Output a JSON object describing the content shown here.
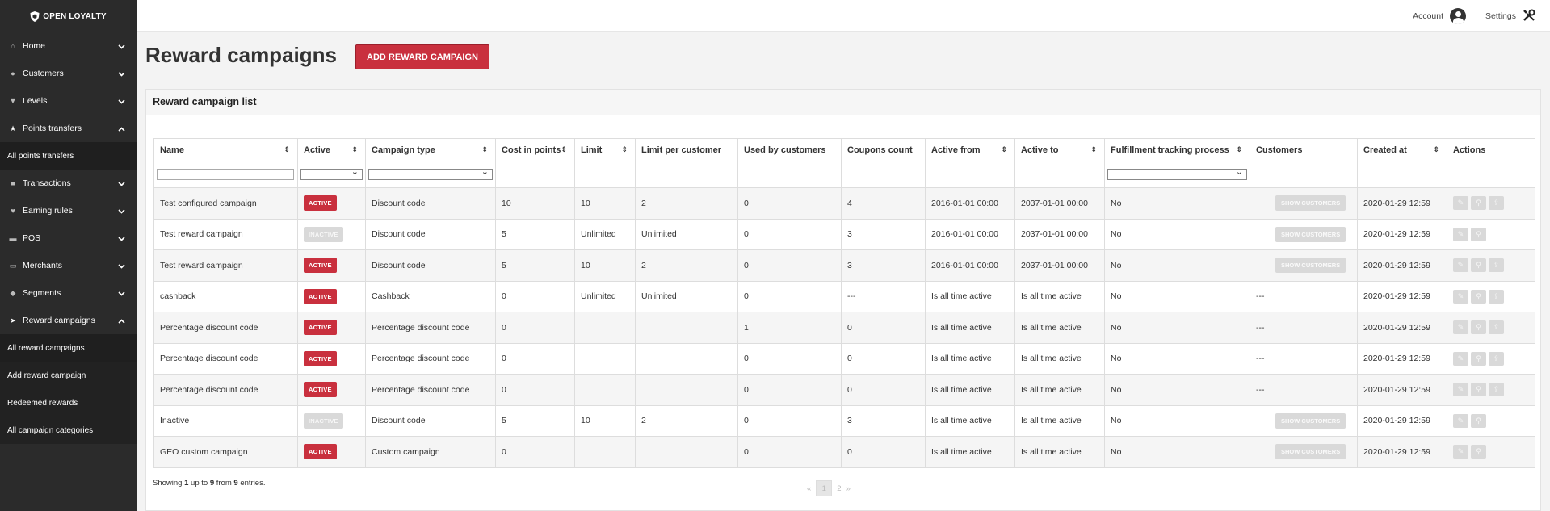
{
  "brand": {
    "name": "OPEN LOYALTY"
  },
  "topbar": {
    "account_label": "Account",
    "settings_label": "Settings"
  },
  "sidebar": {
    "items": [
      {
        "label": "Home",
        "icon": "home-icon",
        "expanded": false
      },
      {
        "label": "Customers",
        "icon": "users-icon",
        "expanded": false
      },
      {
        "label": "Levels",
        "icon": "trophy-icon",
        "expanded": false
      },
      {
        "label": "Points transfers",
        "icon": "star-icon",
        "expanded": true,
        "sub": [
          "All points transfers"
        ]
      },
      {
        "label": "Transactions",
        "icon": "bag-icon",
        "expanded": false
      },
      {
        "label": "Earning rules",
        "icon": "heart-icon",
        "expanded": false
      },
      {
        "label": "POS",
        "icon": "monitor-icon",
        "expanded": false
      },
      {
        "label": "Merchants",
        "icon": "card-icon",
        "expanded": false
      },
      {
        "label": "Segments",
        "icon": "tags-icon",
        "expanded": false
      },
      {
        "label": "Reward campaigns",
        "icon": "send-icon",
        "expanded": true,
        "sub": [
          "All reward campaigns",
          "Add reward campaign",
          "Redeemed rewards",
          "All campaign categories"
        ]
      }
    ]
  },
  "page": {
    "title": "Reward campaigns",
    "add_button": "ADD REWARD CAMPAIGN"
  },
  "panel": {
    "title": "Reward campaign list"
  },
  "table": {
    "columns": [
      "Name",
      "Active",
      "Campaign type",
      "Cost in points",
      "Limit",
      "Limit per customer",
      "Used by customers",
      "Coupons count",
      "Active from",
      "Active to",
      "Fulfillment tracking process",
      "Customers",
      "Created at",
      "Actions"
    ],
    "show_customers_label": "SHOW CUSTOMERS",
    "rows": [
      {
        "name": "Test configured campaign",
        "active": "ACTIVE",
        "type": "Discount code",
        "cost": "10",
        "limit": "10",
        "limit_per_customer": "2",
        "used": "0",
        "coupons": "4",
        "from": "2016-01-01 00:00",
        "to": "2037-01-01 00:00",
        "fulfillment": "No",
        "customers": "",
        "created": "2020-01-29 12:59"
      },
      {
        "name": "Test reward campaign",
        "active": "INACTIVE",
        "type": "Discount code",
        "cost": "5",
        "limit": "Unlimited",
        "limit_per_customer": "Unlimited",
        "used": "0",
        "coupons": "3",
        "from": "2016-01-01 00:00",
        "to": "2037-01-01 00:00",
        "fulfillment": "No",
        "customers": "",
        "created": "2020-01-29 12:59"
      },
      {
        "name": "Test reward campaign",
        "active": "ACTIVE",
        "type": "Discount code",
        "cost": "5",
        "limit": "10",
        "limit_per_customer": "2",
        "used": "0",
        "coupons": "3",
        "from": "2016-01-01 00:00",
        "to": "2037-01-01 00:00",
        "fulfillment": "No",
        "customers": "",
        "created": "2020-01-29 12:59"
      },
      {
        "name": "cashback",
        "active": "ACTIVE",
        "type": "Cashback",
        "cost": "0",
        "limit": "Unlimited",
        "limit_per_customer": "Unlimited",
        "used": "0",
        "coupons": "---",
        "from": "Is all time active",
        "to": "Is all time active",
        "fulfillment": "No",
        "customers": "---",
        "created": "2020-01-29 12:59"
      },
      {
        "name": "Percentage discount code",
        "active": "ACTIVE",
        "type": "Percentage discount code",
        "cost": "0",
        "limit": "",
        "limit_per_customer": "",
        "used": "1",
        "coupons": "0",
        "from": "Is all time active",
        "to": "Is all time active",
        "fulfillment": "No",
        "customers": "---",
        "created": "2020-01-29 12:59"
      },
      {
        "name": "Percentage discount code",
        "active": "ACTIVE",
        "type": "Percentage discount code",
        "cost": "0",
        "limit": "",
        "limit_per_customer": "",
        "used": "0",
        "coupons": "0",
        "from": "Is all time active",
        "to": "Is all time active",
        "fulfillment": "No",
        "customers": "---",
        "created": "2020-01-29 12:59"
      },
      {
        "name": "Percentage discount code",
        "active": "ACTIVE",
        "type": "Percentage discount code",
        "cost": "0",
        "limit": "",
        "limit_per_customer": "",
        "used": "0",
        "coupons": "0",
        "from": "Is all time active",
        "to": "Is all time active",
        "fulfillment": "No",
        "customers": "---",
        "created": "2020-01-29 12:59"
      },
      {
        "name": "Inactive",
        "active": "INACTIVE",
        "type": "Discount code",
        "cost": "5",
        "limit": "10",
        "limit_per_customer": "2",
        "used": "0",
        "coupons": "3",
        "from": "Is all time active",
        "to": "Is all time active",
        "fulfillment": "No",
        "customers": "",
        "created": "2020-01-29 12:59"
      },
      {
        "name": "GEO custom campaign",
        "active": "ACTIVE",
        "type": "Custom campaign",
        "cost": "0",
        "limit": "",
        "limit_per_customer": "",
        "used": "0",
        "coupons": "0",
        "from": "Is all time active",
        "to": "Is all time active",
        "fulfillment": "No",
        "customers": "",
        "created": "2020-01-29 12:59"
      }
    ]
  },
  "footer": {
    "showing_prefix": "Showing ",
    "showing_from": "1",
    "showing_mid1": " up to ",
    "showing_to": "9",
    "showing_mid2": " from ",
    "showing_total": "9",
    "showing_suffix": " entries.",
    "prev": "«",
    "pages": [
      "1",
      "2"
    ],
    "next": "»"
  },
  "colors": {
    "accent": "#c9303e",
    "sidebar_bg": "#2b2b2b",
    "disabled": "#d9d9d9"
  }
}
